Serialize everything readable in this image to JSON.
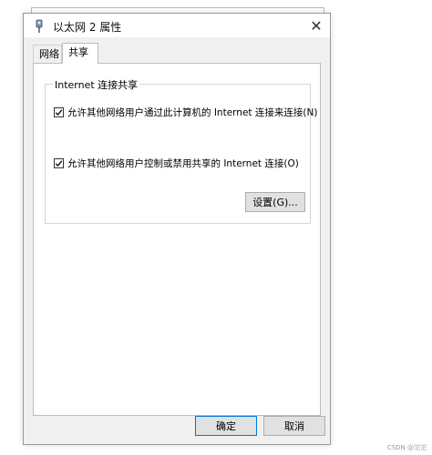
{
  "window": {
    "title": "以太网 2 属性",
    "close_glyph": "✕"
  },
  "tabs": [
    {
      "label": "网络",
      "active": false
    },
    {
      "label": "共享",
      "active": true
    }
  ],
  "sharing": {
    "group_title": "Internet 连接共享",
    "allow_connect": {
      "label": "允许其他网络用户通过此计算机的 Internet 连接来连接(N)",
      "checked": true
    },
    "allow_control": {
      "label": "允许其他网络用户控制或禁用共享的 Internet 连接(O)",
      "checked": true
    },
    "settings_label": "设置(G)..."
  },
  "footer": {
    "ok_label": "确定",
    "cancel_label": "取消"
  },
  "watermark": "CSDN @沱沱",
  "icons": {
    "title": "network-adapter-icon",
    "check": "check-icon",
    "close": "close-icon"
  },
  "colors": {
    "accent": "#0078d7",
    "window_bg": "#f0f0f0",
    "panel_bg": "#ffffff"
  }
}
